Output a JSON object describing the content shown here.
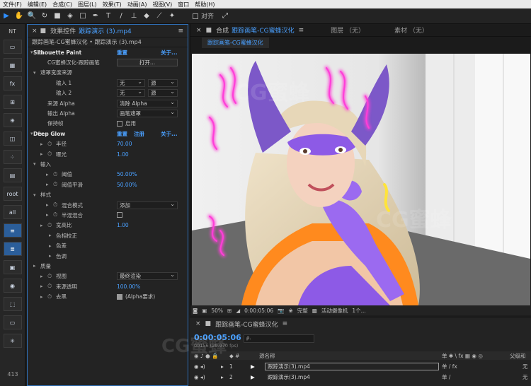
{
  "menubar": {
    "items": [
      "文件(F)",
      "编辑(E)",
      "合成(C)",
      "图层(L)",
      "效果(T)",
      "动画(A)",
      "视图(V)",
      "窗口",
      "帮助(H)"
    ]
  },
  "toolbar": {
    "snap_label": "对齐"
  },
  "left_panel": {
    "top_label": "NT",
    "bottom_num": "413",
    "buttons": [
      "",
      "",
      "fx",
      "",
      "",
      "",
      "",
      "",
      "",
      "root",
      "all",
      "",
      "",
      "",
      "",
      "",
      "",
      "",
      ""
    ]
  },
  "effects_panel": {
    "title_prefix": "效果控件",
    "title_file": "跟踪演示 (3).mp4",
    "subtitle": "跟踪画笔-CG蜜蜂汉化 • 跟踪演示 (3).mp4",
    "rows": [
      {
        "label": "Silhouette Paint",
        "links": [
          "重置",
          "关于..."
        ],
        "fx": true
      },
      {
        "label": "CG蜜蜂汉化-跟踪画笔",
        "button": "打开..."
      },
      {
        "label": "遮罩宽度来源",
        "twirl": true
      },
      {
        "label": "输入 1",
        "drop1": "无",
        "drop2": "源"
      },
      {
        "label": "输入 2",
        "drop1": "无",
        "drop2": "源"
      },
      {
        "label": "来源 Alpha",
        "drop": "清除 Alpha"
      },
      {
        "label": "输出 Alpha",
        "drop": "画笔遮罩"
      },
      {
        "label": "保持帧",
        "check": "启用"
      },
      {
        "label": "Deep Glow",
        "links": [
          "重置",
          "注册",
          "关于..."
        ],
        "fx": true
      },
      {
        "label": "半径",
        "value": "70.00",
        "stopwatch": true
      },
      {
        "label": "曝光",
        "value": "1.00",
        "stopwatch": true
      },
      {
        "label": "输入",
        "twirl": true
      },
      {
        "label": "阈值",
        "value": "50.00%",
        "stopwatch": true
      },
      {
        "label": "阈值平滑",
        "value": "50.00%",
        "stopwatch": true
      },
      {
        "label": "样式",
        "twirl": true
      },
      {
        "label": "混合模式",
        "drop": "添加",
        "stopwatch": true
      },
      {
        "label": "半混混合",
        "checkbox": true,
        "stopwatch": true
      },
      {
        "label": "宽高比",
        "value": "1.00",
        "stopwatch": true
      },
      {
        "label": "色相校正",
        "twirl": true
      },
      {
        "label": "色差",
        "twirl": true
      },
      {
        "label": "色调",
        "twirl": true
      },
      {
        "label": "质量",
        "twirl": true
      },
      {
        "label": "视图",
        "drop": "最终渲染",
        "stopwatch": true
      },
      {
        "label": "来源透明",
        "value": "100.00%",
        "stopwatch": true
      },
      {
        "label": "去黑",
        "checked": "(Alpha要求)",
        "stopwatch": true
      }
    ]
  },
  "composition": {
    "label": "合成",
    "comp_name": "跟踪画笔-CG蜜蜂汉化",
    "layer_label": "图层 （无）",
    "footage_label": "素材 （无）",
    "tab": "跟踪画笔-CG蜜蜂汉化",
    "footer": {
      "zoom": "50%",
      "time": "0:00:05:06",
      "quality": "完整",
      "camera": "活动摄像机",
      "views": "1个..."
    }
  },
  "timeline": {
    "tab": "跟踪画笔-CG蜜蜂汉化",
    "time": "0:00:05:06",
    "fps": "00156 (29.970 fps)",
    "search_placeholder": "ρ.",
    "col_name": "源名称",
    "col_parent": "父级和",
    "layers": [
      {
        "index": "1",
        "name": "跟踪演示(3).mp4",
        "parent": "无"
      },
      {
        "index": "2",
        "name": "跟踪演示(3).mp4",
        "parent": "无"
      }
    ]
  },
  "colors": {
    "accent": "#4aa0ff",
    "panel": "#232323",
    "neon": "#ff3ed8"
  }
}
